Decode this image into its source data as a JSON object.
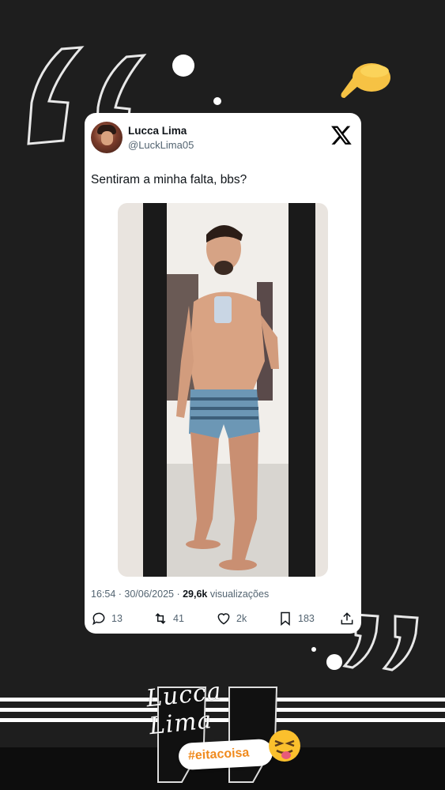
{
  "tweet": {
    "display_name": "Lucca Lima",
    "handle": "@LuckLima05",
    "text": "Sentiram a minha falta, bbs?",
    "time": "16:54",
    "date": "30/06/2025",
    "views_count": "29,6k",
    "views_label": "visualizações",
    "replies": "13",
    "reposts": "41",
    "likes": "2k",
    "bookmarks": "183"
  },
  "story": {
    "signature": "Lucca Lima",
    "hashtag": "#eitacoisa"
  },
  "colors": {
    "background": "#1e1e1e",
    "card": "#ffffff",
    "hashtag": "#f08a1d",
    "secondary_text": "#536471"
  }
}
